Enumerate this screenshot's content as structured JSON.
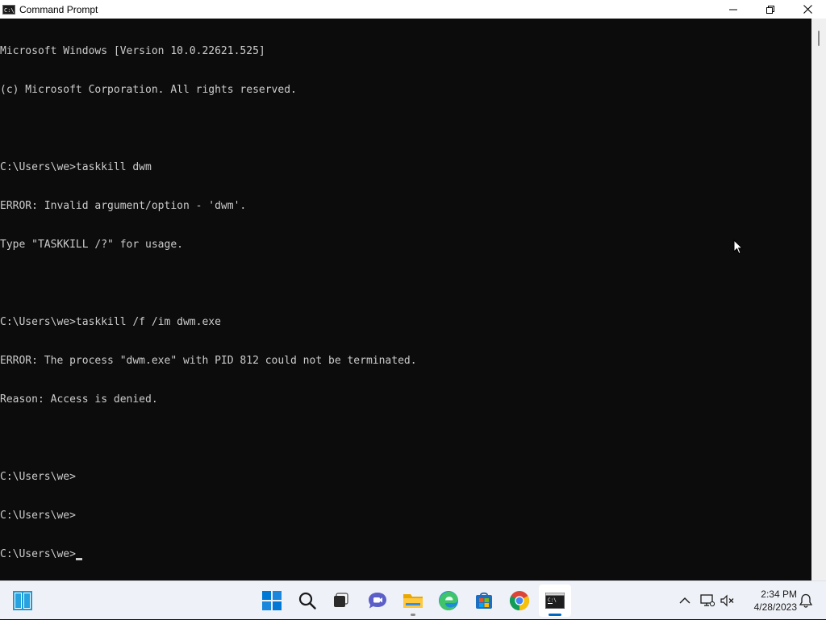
{
  "window": {
    "title": "Command Prompt",
    "icon_label": "C:\\"
  },
  "console": {
    "lines": [
      "Microsoft Windows [Version 10.0.22621.525]",
      "(c) Microsoft Corporation. All rights reserved.",
      "",
      "C:\\Users\\we>taskkill dwm",
      "ERROR: Invalid argument/option - 'dwm'.",
      "Type \"TASKKILL /?\" for usage.",
      "",
      "C:\\Users\\we>taskkill /f /im dwm.exe",
      "ERROR: The process \"dwm.exe\" with PID 812 could not be terminated.",
      "Reason: Access is denied.",
      "",
      "C:\\Users\\we>",
      "C:\\Users\\we>",
      "C:\\Users\\we>"
    ]
  },
  "taskbar": {
    "items": [
      {
        "name": "start-icon"
      },
      {
        "name": "search-icon"
      },
      {
        "name": "task-view-icon"
      },
      {
        "name": "chat-icon"
      },
      {
        "name": "file-explorer-icon"
      },
      {
        "name": "edge-icon"
      },
      {
        "name": "store-icon"
      },
      {
        "name": "chrome-icon"
      },
      {
        "name": "terminal-icon"
      }
    ]
  },
  "clock": {
    "time": "2:34 PM",
    "date": "4/28/2023"
  },
  "colors": {
    "console_bg": "#0c0c0c",
    "console_fg": "#cccccc",
    "taskbar_bg": "#eef1f7",
    "accent": "#0067c0"
  }
}
